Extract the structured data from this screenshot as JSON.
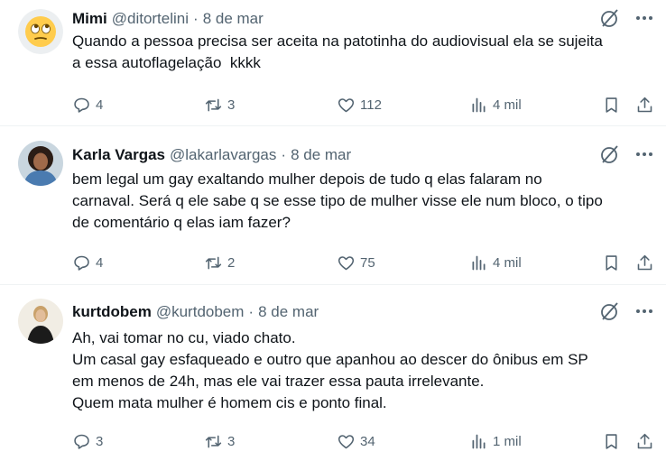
{
  "colors": {
    "text": "#0f1419",
    "secondary": "#536471",
    "border": "#eff3f4"
  },
  "tweets": [
    {
      "name": "Mimi",
      "handle": "@ditortelini",
      "separator": "·",
      "date": "8 de mar",
      "avatar_icon": "rolling-eyes-emoji-icon",
      "lines": [
        "Quando a pessoa precisa ser aceita na patotinha do audiovisual ela se sujeita",
        "a essa autoflagelação  kkkk"
      ],
      "replies": "4",
      "retweets": "3",
      "likes": "112",
      "views": "4 mil"
    },
    {
      "name": "Karla Vargas",
      "handle": "@lakarlavargas",
      "separator": "·",
      "date": "8 de mar",
      "avatar_icon": "profile-photo-icon",
      "lines": [
        "bem legal um gay exaltando mulher depois de tudo q elas falaram no",
        "carnaval. Será q ele sabe q se esse tipo de mulher visse ele num bloco, o tipo",
        "de comentário q elas iam fazer?"
      ],
      "replies": "4",
      "retweets": "2",
      "likes": "75",
      "views": "4 mil"
    },
    {
      "name": "kurtdobem",
      "handle": "@kurtdobem",
      "separator": "·",
      "date": "8 de mar",
      "avatar_icon": "profile-photo-icon",
      "lines": [
        "Ah, vai tomar no cu, viado chato.",
        "Um casal gay esfaqueado e outro que apanhou ao descer do ônibus em SP",
        "em menos de 24h, mas ele vai trazer essa pauta irrelevante.",
        "Quem mata mulher é homem cis e ponto final."
      ],
      "replies": "3",
      "retweets": "3",
      "likes": "34",
      "views": "1 mil"
    }
  ]
}
